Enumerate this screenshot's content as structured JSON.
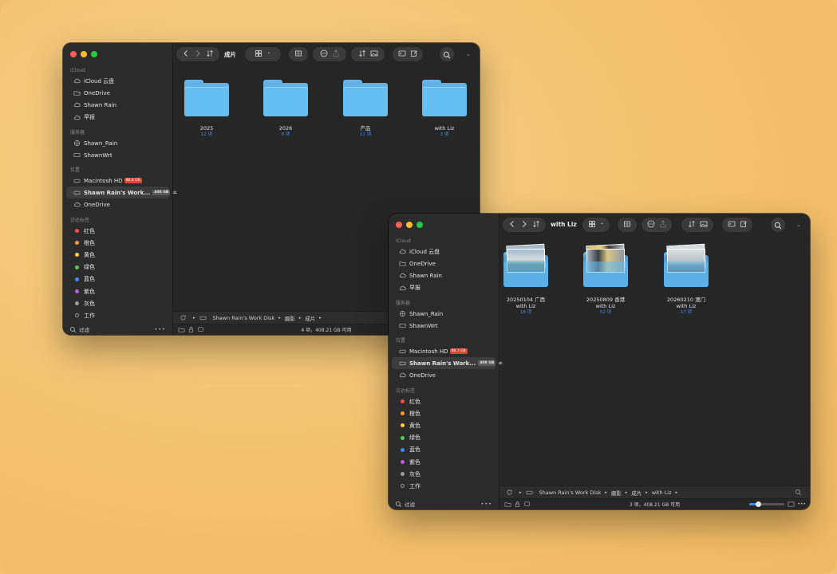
{
  "colors": {
    "background": "#f2c16f",
    "window": "#262626",
    "sidebar": "#2b2b2c",
    "folder": "#66bdf0",
    "count": "#3d8bf0"
  },
  "sidebar": {
    "icloud_head": "iCloud",
    "icloud_items": [
      "iCloud 云盘",
      "OneDrive",
      "Shawn Rain",
      "早报"
    ],
    "server_head": "服务器",
    "server_items": [
      "Shawn_Rain",
      "ShawnWrt"
    ],
    "location_head": "位置",
    "locations": [
      {
        "label": "Macintosh HD",
        "badge": "88.8 GB"
      },
      {
        "label": "Shawn Rain's Work...",
        "badge": "408 GB"
      },
      {
        "label": "OneDrive"
      }
    ],
    "locations_b": [
      {
        "label": "Macintosh HD",
        "badge": "88.7 GB"
      },
      {
        "label": "Shawn Rain's Work...",
        "badge": "408 GB"
      },
      {
        "label": "OneDrive"
      }
    ],
    "tags_head": "访达标签",
    "tags": [
      {
        "label": "红色",
        "color": "#f0524a"
      },
      {
        "label": "橙色",
        "color": "#f39a3c"
      },
      {
        "label": "黄色",
        "color": "#f7cf45"
      },
      {
        "label": "绿色",
        "color": "#5bc55a"
      },
      {
        "label": "蓝色",
        "color": "#3d8bf0"
      },
      {
        "label": "紫色",
        "color": "#b760d6"
      },
      {
        "label": "灰色",
        "color": "#9a9a9a"
      },
      {
        "label": "工作",
        "color": "none"
      }
    ],
    "filter_label": "过滤"
  },
  "window_a": {
    "title": "成片",
    "folders": [
      {
        "name": "2025",
        "count": "12 项"
      },
      {
        "name": "2026",
        "count": "8 项"
      },
      {
        "name": "产品",
        "count": "11 项"
      },
      {
        "name": "with Liz",
        "count": "3 项"
      }
    ],
    "path": [
      "Shawn Rain's Work Disk",
      "摄影",
      "成片"
    ],
    "status": "4 项，408.21 GB 可用"
  },
  "window_b": {
    "title": "with Liz",
    "folders": [
      {
        "name": "20250104 广西 with Liz",
        "count": "18 项"
      },
      {
        "name": "20250809 香港 with Liz",
        "count": "52 项"
      },
      {
        "name": "20260210 澳门 with Liz",
        "count": "17 项"
      }
    ],
    "path": [
      "Shawn Rain's Work Disk",
      "摄影",
      "成片",
      "with Liz"
    ],
    "status": "3 项，408.21 GB 可用"
  },
  "icons": [
    "search-icon",
    "share-icon",
    "more-icon",
    "sort-icon",
    "grid-icon",
    "tag-icon",
    "terminal-icon",
    "edit-icon",
    "chevron-left-icon",
    "chevron-right-icon"
  ]
}
